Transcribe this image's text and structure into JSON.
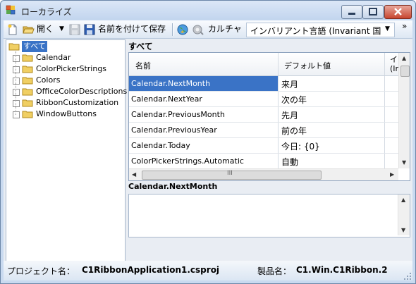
{
  "window": {
    "title": "ローカライズ",
    "colors": {
      "selection": "#3a73c6",
      "frame": "#c9daf0"
    }
  },
  "toolbar": {
    "open_label": "開く",
    "save_as_label": "名前を付けて保存",
    "culture_label": "カルチャ",
    "culture_value": "インバリアント言語 (Invariant 国",
    "overflow": "»"
  },
  "tree": {
    "root": "すべて",
    "items": [
      "Calendar",
      "ColorPickerStrings",
      "Colors",
      "OfficeColorDescriptions",
      "RibbonCustomization",
      "WindowButtons"
    ]
  },
  "grid": {
    "section_title": "すべて",
    "columns": [
      "名前",
      "デフォルト値",
      "イ(In"
    ],
    "rows": [
      {
        "name": "Calendar.NextMonth",
        "default": "来月",
        "selected": true
      },
      {
        "name": "Calendar.NextYear",
        "default": "次の年"
      },
      {
        "name": "Calendar.PreviousMonth",
        "default": "先月"
      },
      {
        "name": "Calendar.PreviousYear",
        "default": "前の年"
      },
      {
        "name": "Calendar.Today",
        "default": "今日: {0}"
      },
      {
        "name": "ColorPickerStrings.Automatic",
        "default": "自動"
      }
    ],
    "hscroll_grip": "III"
  },
  "detail": {
    "title": "Calendar.NextMonth"
  },
  "status": {
    "project_label": "プロジェクト名：",
    "project_value": "C1RibbonApplication1.csproj",
    "product_label": "製品名：",
    "product_value": "C1.Win.C1Ribbon.2"
  }
}
